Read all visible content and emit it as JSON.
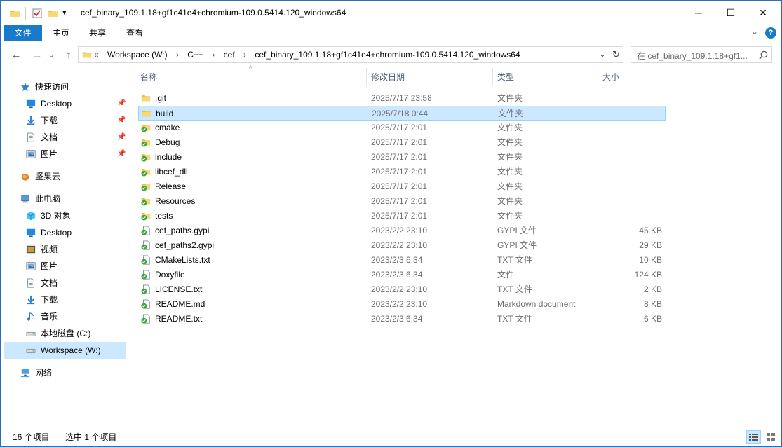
{
  "window": {
    "title": "cef_binary_109.1.18+gf1c41e4+chromium-109.0.5414.120_windows64"
  },
  "title_controls": {
    "minimize": "─",
    "maximize": "☐",
    "close": "✕",
    "expand_ribbon": "⌄",
    "help": "?"
  },
  "ribbon": {
    "tabs": [
      "文件",
      "主页",
      "共享",
      "查看"
    ]
  },
  "nav": {
    "back": "←",
    "forward": "→",
    "recent": "⌄",
    "up": "↑",
    "refresh": "↻",
    "dropdown": "⌄"
  },
  "address": {
    "overflow": "«",
    "crumbs": [
      "Workspace (W:)",
      "C++",
      "cef",
      "cef_binary_109.1.18+gf1c41e4+chromium-109.0.5414.120_windows64"
    ],
    "separator": "›"
  },
  "search": {
    "placeholder": "在 cef_binary_109.1.18+gf1...",
    "icon": "search-icon"
  },
  "navpane": {
    "items": [
      {
        "label": "快速访问",
        "icon": "star-icon"
      },
      {
        "label": "Desktop",
        "icon": "desktop-icon",
        "pinned": true
      },
      {
        "label": "下载",
        "icon": "download-icon",
        "pinned": true
      },
      {
        "label": "文档",
        "icon": "document-icon",
        "pinned": true
      },
      {
        "label": "图片",
        "icon": "picture-icon",
        "pinned": true
      },
      {
        "label": "坚果云",
        "icon": "nut-cloud-icon"
      },
      {
        "label": "此电脑",
        "icon": "computer-icon"
      },
      {
        "label": "3D 对象",
        "icon": "cube-icon"
      },
      {
        "label": "Desktop",
        "icon": "desktop-icon"
      },
      {
        "label": "视频",
        "icon": "video-icon"
      },
      {
        "label": "图片",
        "icon": "picture-icon"
      },
      {
        "label": "文档",
        "icon": "document-icon"
      },
      {
        "label": "下载",
        "icon": "download-icon"
      },
      {
        "label": "音乐",
        "icon": "music-icon"
      },
      {
        "label": "本地磁盘 (C:)",
        "icon": "drive-icon"
      },
      {
        "label": "Workspace (W:)",
        "icon": "drive-icon",
        "selected": true
      },
      {
        "label": "网络",
        "icon": "network-icon"
      }
    ],
    "pin_glyph": "📌"
  },
  "filelist": {
    "columns": [
      "名称",
      "修改日期",
      "类型",
      "大小"
    ],
    "sort_indicator": "^",
    "rows": [
      {
        "name": ".git",
        "date": "2025/7/17 23:58",
        "type": "文件夹",
        "size": "",
        "icon": "folder-icon"
      },
      {
        "name": "build",
        "date": "2025/7/18 0:44",
        "type": "文件夹",
        "size": "",
        "icon": "folder-icon",
        "selected": true
      },
      {
        "name": "cmake",
        "date": "2025/7/17 2:01",
        "type": "文件夹",
        "size": "",
        "icon": "synced-folder-icon"
      },
      {
        "name": "Debug",
        "date": "2025/7/17 2:01",
        "type": "文件夹",
        "size": "",
        "icon": "synced-folder-icon"
      },
      {
        "name": "include",
        "date": "2025/7/17 2:01",
        "type": "文件夹",
        "size": "",
        "icon": "synced-folder-icon"
      },
      {
        "name": "libcef_dll",
        "date": "2025/7/17 2:01",
        "type": "文件夹",
        "size": "",
        "icon": "synced-folder-icon"
      },
      {
        "name": "Release",
        "date": "2025/7/17 2:01",
        "type": "文件夹",
        "size": "",
        "icon": "synced-folder-icon"
      },
      {
        "name": "Resources",
        "date": "2025/7/17 2:01",
        "type": "文件夹",
        "size": "",
        "icon": "synced-folder-icon"
      },
      {
        "name": "tests",
        "date": "2025/7/17 2:01",
        "type": "文件夹",
        "size": "",
        "icon": "synced-folder-icon"
      },
      {
        "name": "cef_paths.gypi",
        "date": "2023/2/2 23:10",
        "type": "GYPI 文件",
        "size": "45 KB",
        "icon": "synced-file-icon"
      },
      {
        "name": "cef_paths2.gypi",
        "date": "2023/2/2 23:10",
        "type": "GYPI 文件",
        "size": "29 KB",
        "icon": "synced-file-icon"
      },
      {
        "name": "CMakeLists.txt",
        "date": "2023/2/3 6:34",
        "type": "TXT 文件",
        "size": "10 KB",
        "icon": "synced-file-icon"
      },
      {
        "name": "Doxyfile",
        "date": "2023/2/3 6:34",
        "type": "文件",
        "size": "124 KB",
        "icon": "synced-file-icon"
      },
      {
        "name": "LICENSE.txt",
        "date": "2023/2/2 23:10",
        "type": "TXT 文件",
        "size": "2 KB",
        "icon": "synced-file-icon"
      },
      {
        "name": "README.md",
        "date": "2023/2/2 23:10",
        "type": "Markdown document",
        "size": "8 KB",
        "icon": "synced-file-icon"
      },
      {
        "name": "README.txt",
        "date": "2023/2/3 6:34",
        "type": "TXT 文件",
        "size": "6 KB",
        "icon": "synced-file-icon"
      }
    ]
  },
  "status": {
    "item_count": "16 个项目",
    "selected": "选中 1 个项目"
  },
  "colors": {
    "accent": "#1979ca",
    "selection": "#cce8ff",
    "selection_border": "#99d1ff",
    "folder": "#f4c042",
    "sync_green": "#3aa63a"
  }
}
